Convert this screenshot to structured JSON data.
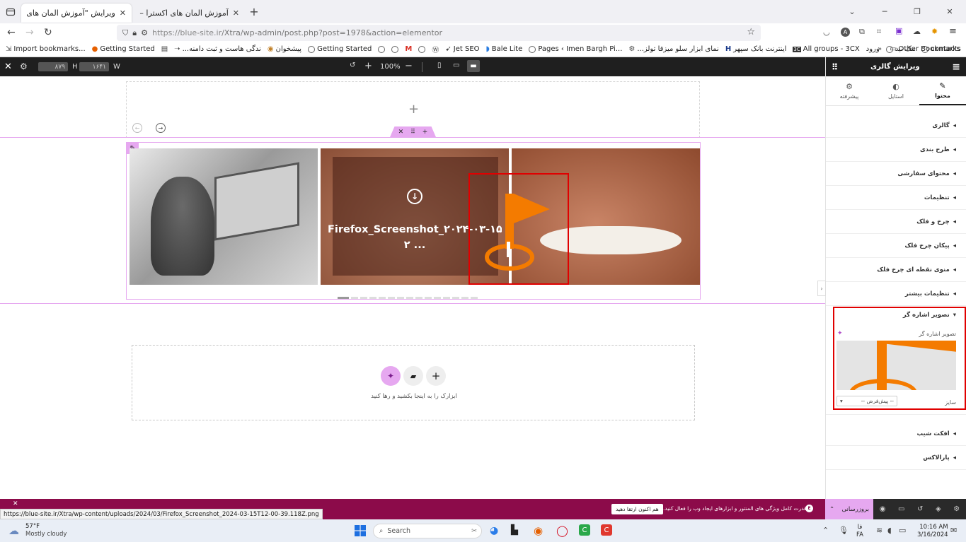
{
  "browser": {
    "tabs": [
      {
        "label": "ویرایش \"آموزش المان های اکسترا\" ‹ ...",
        "active": true
      },
      {
        "label": "آموزش المان های اکسترا – علاءالدین",
        "active": false
      }
    ],
    "url_prefix": "https://blue-site.ir",
    "url_path": "/Xtra/wp-admin/post.php?post=1978&action=elementor",
    "bookmarks": [
      "Import bookmarks...",
      "Getting Started",
      "...ندگی هاست و ثبت دامنه",
      "پیشخوان",
      "Getting Started",
      "Jet SEO",
      "Bale Lite",
      "Pages ‹ Imen Bargh Pi...",
      "...نمای ابزار سلو میزفا تولز",
      "اینترنت بانک سپهر",
      "All groups - 3CX",
      "ورود",
      "مک نید",
      "contacts"
    ],
    "other_bookmarks": "Other Bookmarks"
  },
  "editor_top": {
    "w_label": "W",
    "w_value": "۱۶۴۱",
    "h_label": "H",
    "h_value": "۸۷۹",
    "zoom": "100%"
  },
  "canvas": {
    "gallery_caption_line1": "Firefox_Screenshot_۲۰۲۴-۰۳-۱۵T1",
    "gallery_caption_line2": "۲ ...",
    "dropzone_hint": "ابزارک را به اینجا بکشید و رها کنید"
  },
  "panel": {
    "title": "ویرایش گالری",
    "tabs": [
      "محتوا",
      "استایل",
      "پیشرفته"
    ],
    "sections_top": [
      "گالری",
      "طرح بندی",
      "محتوای سفارشی",
      "تنظیمات",
      "چرخ و فلک",
      "پیکان چرخ فلک",
      "منوی نقطه ای چرخ فلک",
      "تنظیمات بیشتر"
    ],
    "open_section": "تصویر اشاره گر",
    "open_section_field_label": "تصویر اشاره گر",
    "size_label": "سایز",
    "size_value": "-- پیش‌فرض --",
    "sections_bottom": [
      "افکت شیب",
      "پارالاکس"
    ]
  },
  "bottom_bar": {
    "promo_text": "قدرت کامل ویژگی های المنتور و ابزارهای ایجاد وب را فعال کنید.",
    "promo_button": "هم اکنون ارتقا دهید",
    "update_button": "بروزرسانی",
    "status_url": "https://blue-site.ir/Xtra/wp-content/uploads/2024/03/Firefox_Screenshot_2024-03-15T12-00-39.118Z.png"
  },
  "taskbar": {
    "weather_temp": "57°F",
    "weather_desc": "Mostly cloudy",
    "search_placeholder": "Search",
    "lang_top": "فا",
    "lang_bottom": "FA",
    "time": "10:16 AM",
    "date": "3/16/2024"
  },
  "colors": {
    "accent_pink": "#e6a8f0",
    "elementor_maroon": "#8c0b4a",
    "highlight_red": "#e00000",
    "flag_orange": "#f47b00"
  }
}
